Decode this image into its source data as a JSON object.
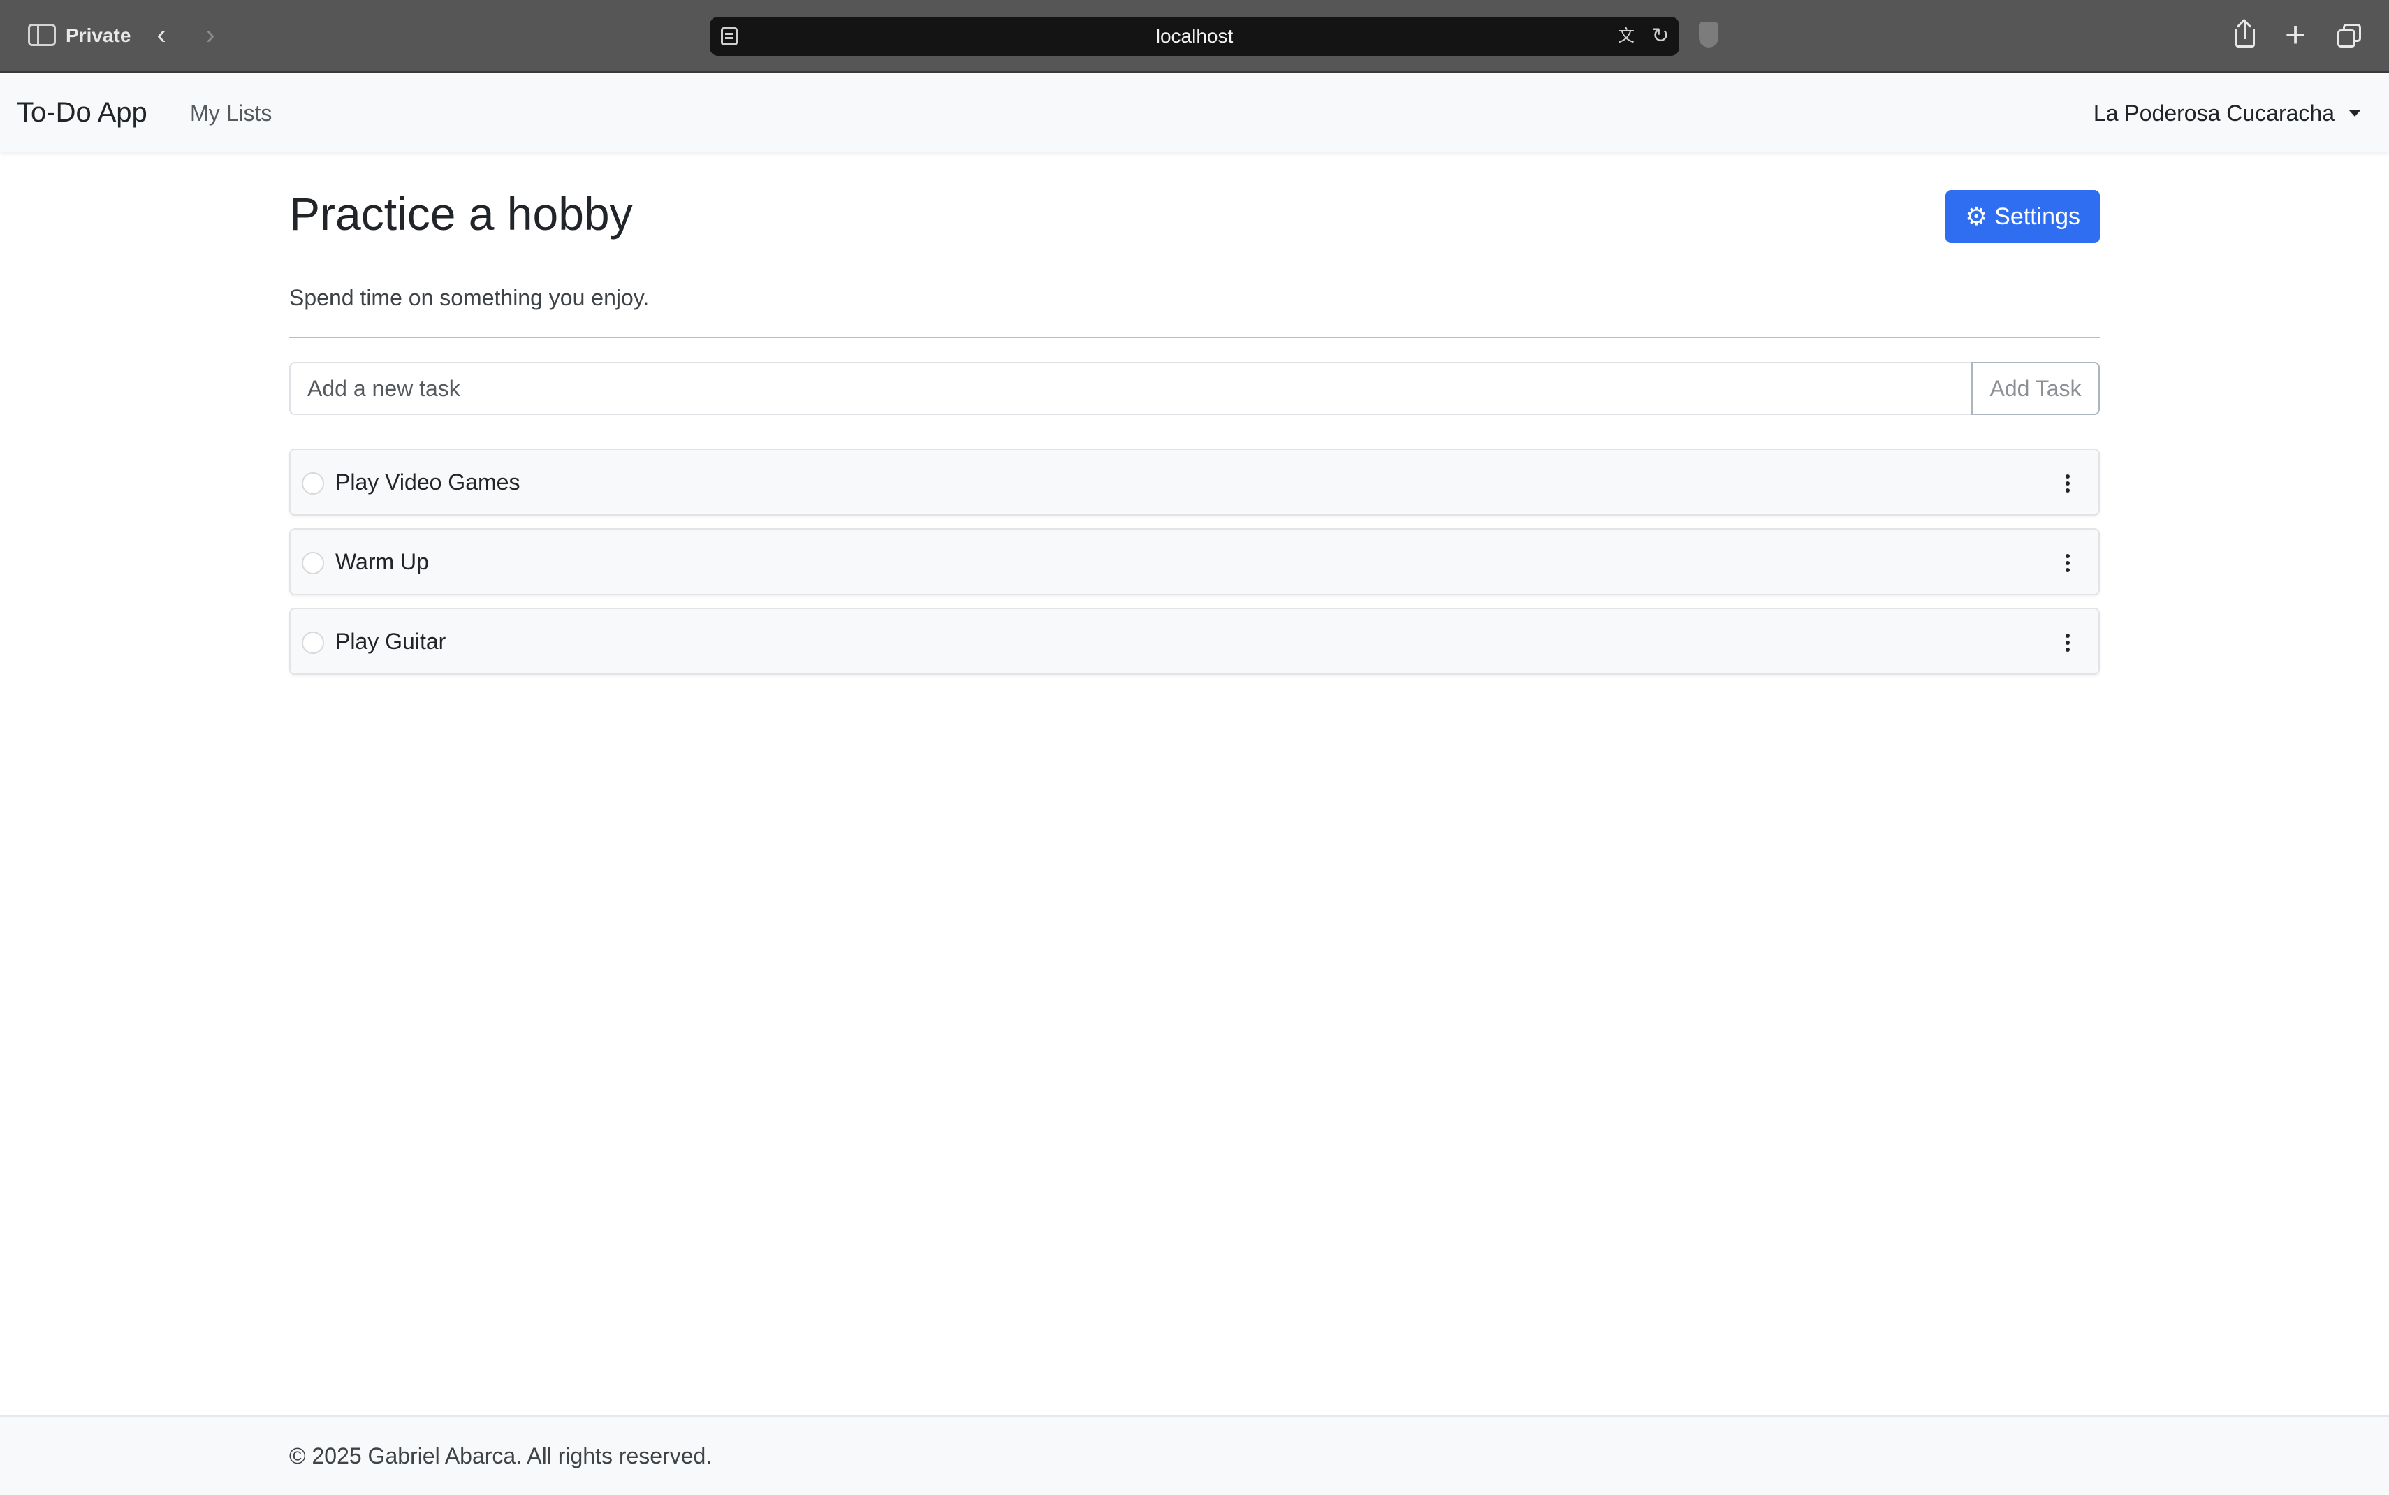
{
  "browser": {
    "private_label": "Private",
    "url": "localhost",
    "icons": {
      "sidebar": "sidebar-icon",
      "back": "chevron-left-icon",
      "forward": "chevron-right-icon",
      "page": "page-menu-icon",
      "translate": "translate-icon",
      "reload": "reload-icon",
      "privacy": "shield-icon",
      "share": "share-icon",
      "new_tab": "plus-icon",
      "tab_overview": "tabs-icon"
    }
  },
  "navbar": {
    "brand": "To-Do App",
    "link": "My Lists",
    "user": "La Poderosa Cucaracha"
  },
  "list": {
    "title": "Practice a hobby",
    "description": "Spend time on something you enjoy.",
    "settings_label": "Settings",
    "accent_color": "#2f6ef0"
  },
  "form": {
    "placeholder": "Add a new task",
    "value": "",
    "button_label": "Add Task"
  },
  "tasks": [
    {
      "label": "Play Video Games",
      "done": false
    },
    {
      "label": "Warm Up",
      "done": false
    },
    {
      "label": "Play Guitar",
      "done": false
    }
  ],
  "footer": {
    "text": "© 2025 Gabriel Abarca. All rights reserved."
  }
}
